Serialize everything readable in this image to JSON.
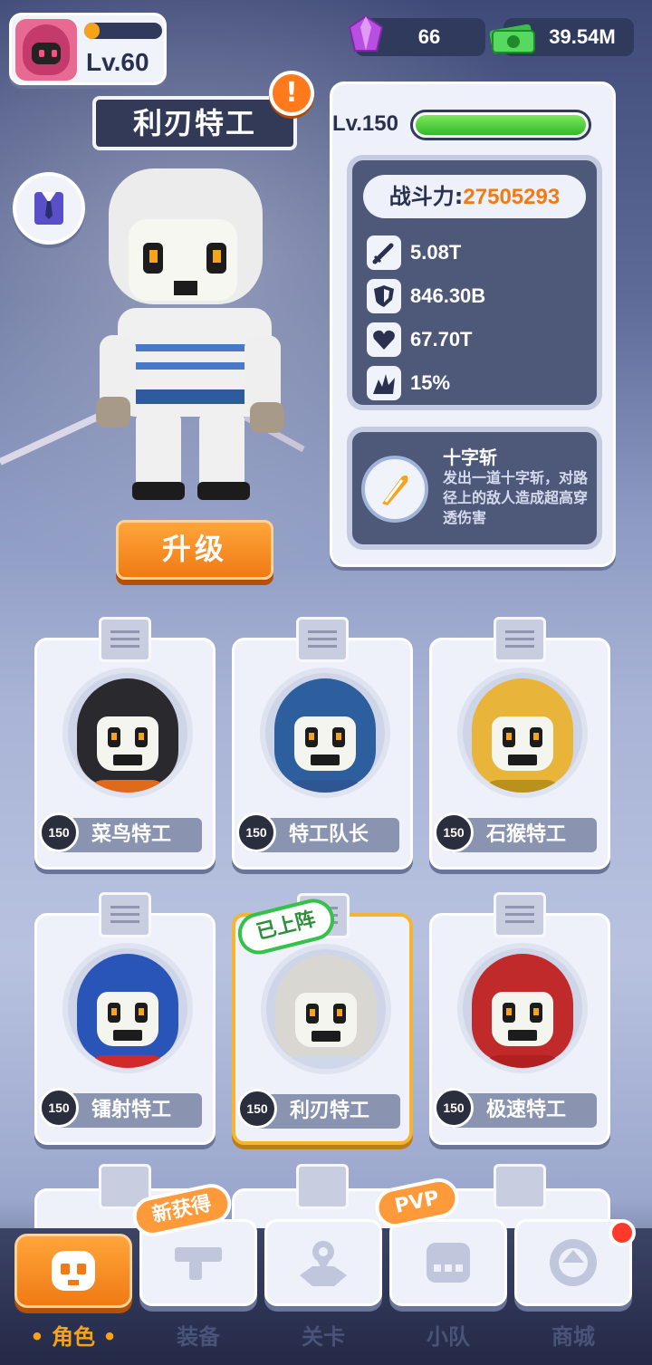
{
  "player": {
    "level": "Lv.60",
    "xp_fraction": 0.2
  },
  "currency": {
    "gems": "66",
    "cash": "39.54M"
  },
  "hero": {
    "name": "利刃特工",
    "level": "Lv.150",
    "hp_fraction": 1.0,
    "power_label": "战斗力:",
    "power_value": "27505293",
    "stats": [
      {
        "icon": "sword-icon",
        "value": "5.08T"
      },
      {
        "icon": "shield-icon",
        "value": "846.30B"
      },
      {
        "icon": "heart-icon",
        "value": "67.70T"
      },
      {
        "icon": "crit-icon",
        "value": "15%"
      }
    ],
    "skill": {
      "name": "十字斩",
      "desc": "发出一道十字斩，对路径上的敌人造成超高穿透伤害"
    },
    "upgrade_label": "升级"
  },
  "cards": [
    {
      "level": "150",
      "name": "菜鸟特工",
      "hood": "#2a2a2e",
      "body": "#e06a1c"
    },
    {
      "level": "150",
      "name": "特工队长",
      "hood": "#2d5f9e",
      "body": "#2f5592"
    },
    {
      "level": "150",
      "name": "石猴特工",
      "hood": "#e8b53a",
      "body": "#b8921c"
    },
    {
      "level": "150",
      "name": "镭射特工",
      "hood": "#2a55b8",
      "body": "#d02a2a"
    },
    {
      "level": "150",
      "name": "利刃特工",
      "hood": "#d9d7d2",
      "body": "#cfd7ea",
      "equipped": "已上阵"
    },
    {
      "level": "150",
      "name": "极速特工",
      "hood": "#c02a2a",
      "body": "#b02020"
    }
  ],
  "nav": {
    "tabs": [
      "角色",
      "装备",
      "关卡",
      "小队",
      "商城"
    ],
    "badges": {
      "new": "新获得",
      "pvp": "PVP"
    }
  },
  "colors": {
    "accent": "#f07a14",
    "power": "#f07a14",
    "equipped": "#35c24a"
  }
}
